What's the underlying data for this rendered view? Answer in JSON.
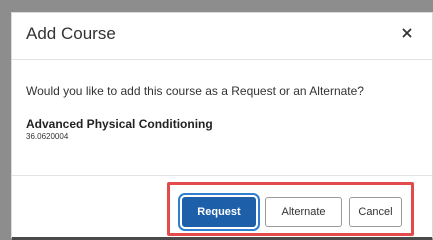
{
  "dialog": {
    "title": "Add Course",
    "close_icon": "close-icon",
    "question": "Would you like to add this course as a Request or an Alternate?",
    "course": {
      "name": "Advanced Physical Conditioning",
      "code": "36.0620004"
    },
    "buttons": {
      "request": "Request",
      "alternate": "Alternate",
      "cancel": "Cancel"
    }
  },
  "colors": {
    "primary_button": "#1d5fa8",
    "highlight_box": "#e34b4b"
  }
}
